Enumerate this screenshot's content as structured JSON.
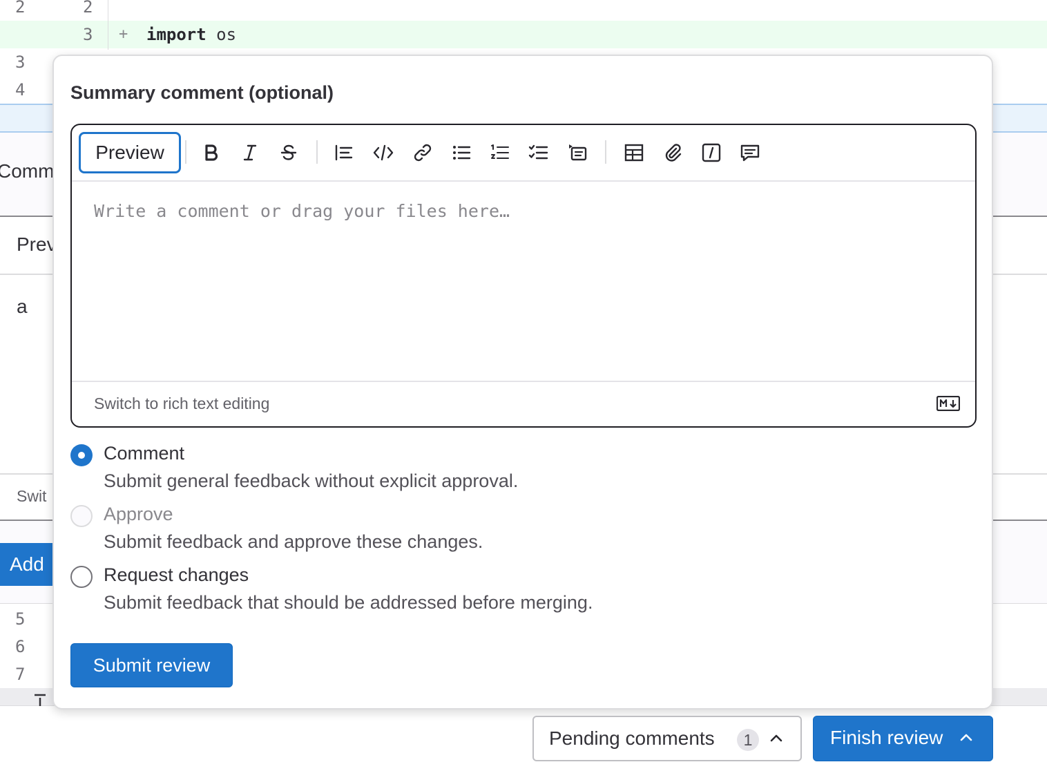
{
  "diff": {
    "rows": [
      {
        "old": "2",
        "new": "2"
      },
      {
        "old": "",
        "new": "3",
        "marker": "+",
        "code_keyword": "import",
        "code_rest": " os"
      },
      {
        "old": "3",
        "new": ""
      },
      {
        "old": "4",
        "new": ""
      }
    ],
    "bg_comment_tab": "Comm",
    "bg_preview_tab": "Prev",
    "bg_comment_text": "a",
    "bg_switch_text": "Swit",
    "bg_add_button": "Add",
    "lower_lines": [
      "5",
      "6",
      "7"
    ],
    "added_color": "#ecfdf0"
  },
  "review": {
    "title": "Summary comment (optional)",
    "editor": {
      "preview_label": "Preview",
      "toolbar_icons": [
        "bold-icon",
        "italic-icon",
        "strikethrough-icon",
        "quote-icon",
        "code-icon",
        "link-icon",
        "bullet-list-icon",
        "numbered-list-icon",
        "task-list-icon",
        "collapsible-section-icon",
        "table-icon",
        "attach-file-icon",
        "quick-actions-icon",
        "comment-icon"
      ],
      "placeholder": "Write a comment or drag your files here…",
      "switch_label": "Switch to rich text editing",
      "markdown_icon": "markdown-icon"
    },
    "options": [
      {
        "label": "Comment",
        "help": "Submit general feedback without explicit approval.",
        "checked": true,
        "disabled": false
      },
      {
        "label": "Approve",
        "help": "Submit feedback and approve these changes.",
        "checked": false,
        "disabled": true
      },
      {
        "label": "Request changes",
        "help": "Submit feedback that should be addressed before merging.",
        "checked": false,
        "disabled": false
      }
    ],
    "submit_label": "Submit review"
  },
  "footer": {
    "pending_label": "Pending comments",
    "pending_count": "1",
    "finish_label": "Finish review"
  },
  "colors": {
    "accent": "#1f75cb",
    "text": "#333238"
  }
}
